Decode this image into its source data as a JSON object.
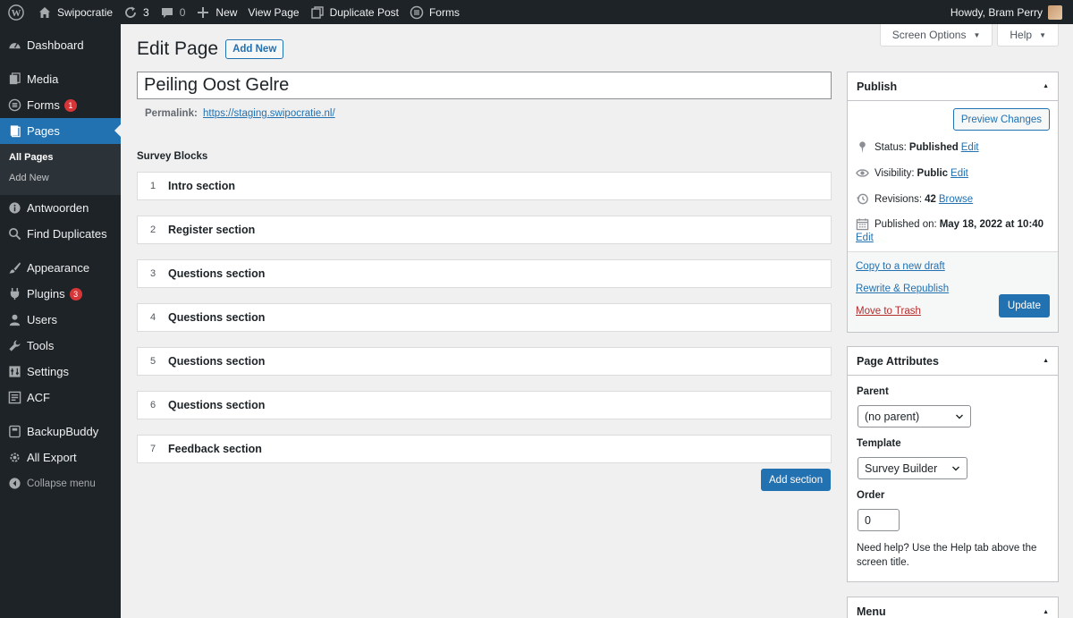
{
  "admin_bar": {
    "site_name": "Swipocratie",
    "updates_count": "3",
    "comments_count": "0",
    "new_label": "New",
    "view_page": "View Page",
    "duplicate_post": "Duplicate Post",
    "forms": "Forms",
    "howdy": "Howdy, Bram Perry"
  },
  "sidebar": {
    "dashboard": "Dashboard",
    "media": "Media",
    "forms": "Forms",
    "forms_badge": "1",
    "pages": "Pages",
    "all_pages": "All Pages",
    "add_new": "Add New",
    "antwoorden": "Antwoorden",
    "find_duplicates": "Find Duplicates",
    "appearance": "Appearance",
    "plugins": "Plugins",
    "plugins_badge": "3",
    "users": "Users",
    "tools": "Tools",
    "settings": "Settings",
    "acf": "ACF",
    "backupbuddy": "BackupBuddy",
    "all_export": "All Export",
    "collapse": "Collapse menu"
  },
  "screen_meta": {
    "screen_options": "Screen Options",
    "help": "Help"
  },
  "header": {
    "title": "Edit Page",
    "add_new": "Add New"
  },
  "post": {
    "title": "Peiling Oost Gelre",
    "permalink_label": "Permalink:",
    "permalink_url": "https://staging.swipocratie.nl/"
  },
  "survey": {
    "label": "Survey Blocks",
    "blocks": [
      {
        "num": "1",
        "title": "Intro section"
      },
      {
        "num": "2",
        "title": "Register section"
      },
      {
        "num": "3",
        "title": "Questions section"
      },
      {
        "num": "4",
        "title": "Questions section"
      },
      {
        "num": "5",
        "title": "Questions section"
      },
      {
        "num": "6",
        "title": "Questions section"
      },
      {
        "num": "7",
        "title": "Feedback section"
      }
    ],
    "add_section": "Add section"
  },
  "publish": {
    "title": "Publish",
    "preview": "Preview Changes",
    "status_label": "Status:",
    "status_value": "Published",
    "visibility_label": "Visibility:",
    "visibility_value": "Public",
    "revisions_label": "Revisions:",
    "revisions_value": "42",
    "browse": "Browse",
    "published_label": "Published on:",
    "published_value": "May 18, 2022 at 10:40",
    "edit": "Edit",
    "copy_draft": "Copy to a new draft",
    "rewrite": "Rewrite & Republish",
    "trash": "Move to Trash",
    "update": "Update"
  },
  "attributes": {
    "title": "Page Attributes",
    "parent_label": "Parent",
    "parent_value": "(no parent)",
    "template_label": "Template",
    "template_value": "Survey Builder",
    "order_label": "Order",
    "order_value": "0",
    "help": "Need help? Use the Help tab above the screen title."
  },
  "menu_box": {
    "title": "Menu"
  }
}
